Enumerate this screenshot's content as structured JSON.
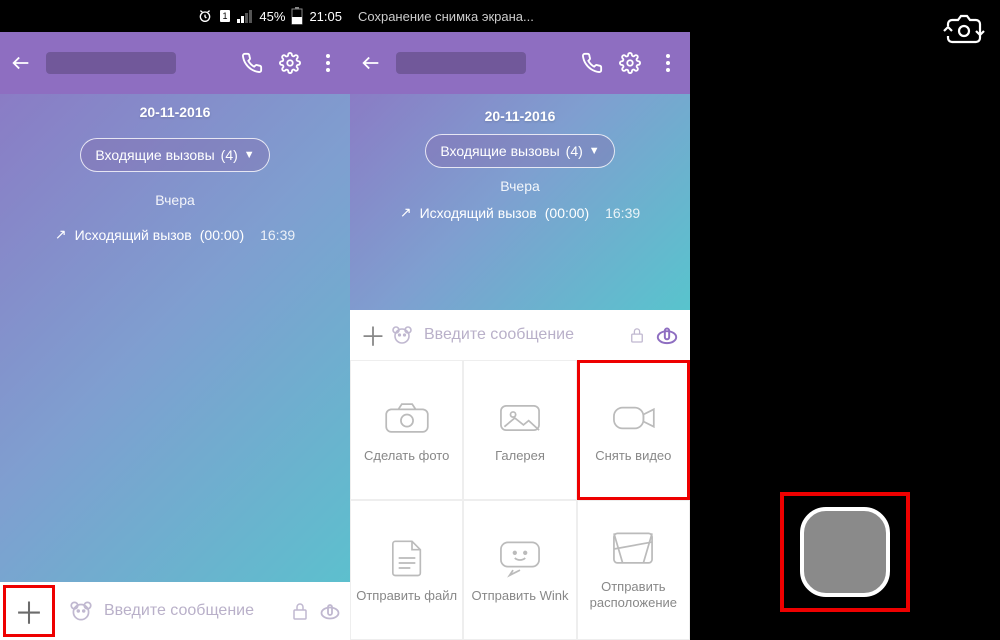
{
  "status": {
    "battery": "45%",
    "time": "21:05",
    "saving": "Сохранение снимка экрана..."
  },
  "chat": {
    "date": "20-11-2016",
    "incoming_label": "Входящие вызовы",
    "incoming_count": "(4)",
    "yesterday": "Вчера",
    "outgoing": "Исходящий вызов",
    "duration": "(00:00)",
    "out_time": "16:39"
  },
  "input": {
    "placeholder": "Введите сообщение"
  },
  "attachments": {
    "a1": "Сделать фото",
    "a2": "Галерея",
    "a3": "Снять видео",
    "a4": "Отправить файл",
    "a5": "Отправить Wink",
    "a6": "Отправить расположение"
  }
}
